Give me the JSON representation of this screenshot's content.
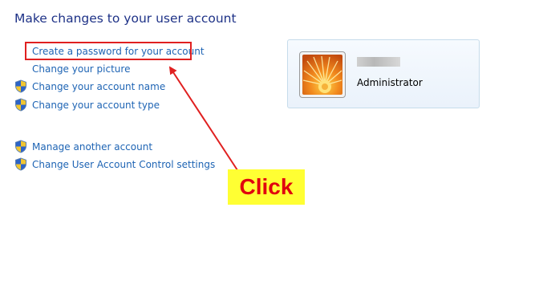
{
  "page": {
    "title": "Make changes to your user account"
  },
  "tasks": [
    {
      "label": "Create a password for your account",
      "shield": false
    },
    {
      "label": "Change your picture",
      "shield": false
    },
    {
      "label": "Change your account name",
      "shield": true
    },
    {
      "label": "Change your account type",
      "shield": true
    },
    {
      "label": "Manage another account",
      "shield": true
    },
    {
      "label": "Change User Account Control settings",
      "shield": true
    }
  ],
  "user_card": {
    "account_type": "Administrator",
    "picture_icon": "orange-flower-icon"
  },
  "annotation": {
    "callout_text": "Click",
    "callout_bg": "#ffff33",
    "callout_color": "#e0000e",
    "arrow_color": "#e02020"
  },
  "colors": {
    "title": "#1e3287",
    "link": "#1e64b4"
  }
}
